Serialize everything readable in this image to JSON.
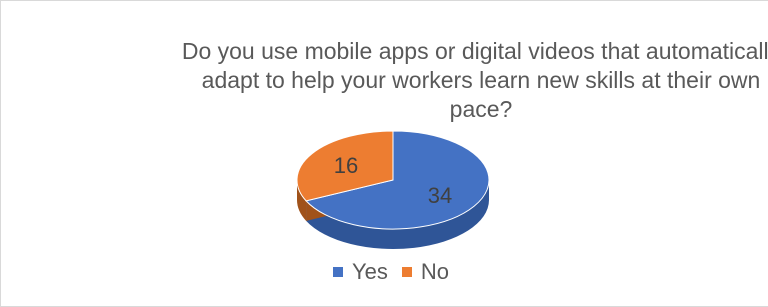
{
  "chart_data": {
    "type": "pie",
    "title_lines": [
      "Do you use mobile apps or digital videos that automatically",
      "adapt to help your workers learn new skills at their own",
      "pace?"
    ],
    "categories": [
      "Yes",
      "No"
    ],
    "values": [
      34,
      16
    ],
    "colors": [
      "#4472C4",
      "#ED7D31"
    ],
    "side_colors": [
      "#2F5597",
      "#A0521A"
    ],
    "legend_position": "bottom",
    "data_labels": [
      "34",
      "16"
    ],
    "style": "3d"
  }
}
